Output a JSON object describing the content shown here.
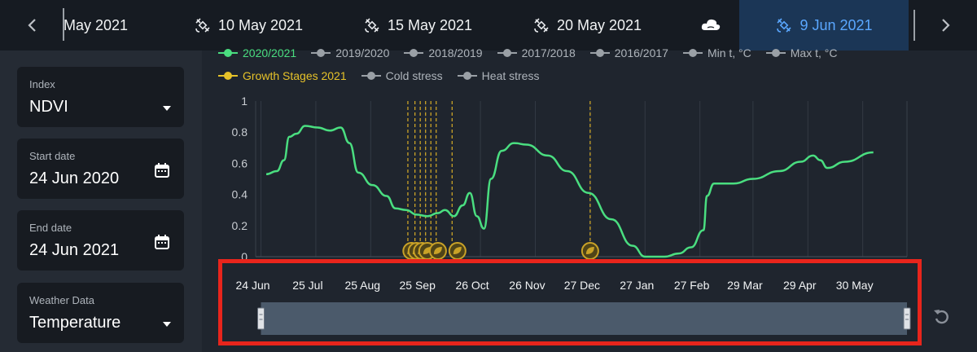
{
  "topbar": {
    "prev_icon": "chevron-left-icon",
    "next_icon": "chevron-right-icon",
    "dates": [
      {
        "label": "May 2021",
        "icon": "none"
      },
      {
        "label": "10 May 2021",
        "icon": "satellite-icon"
      },
      {
        "label": "15 May 2021",
        "icon": "satellite-icon"
      },
      {
        "label": "20 May 2021",
        "icon": "satellite-icon"
      },
      {
        "label": "",
        "icon": "cloud-icon"
      },
      {
        "label": "9 Jun 2021",
        "icon": "satellite-icon",
        "active": true
      }
    ]
  },
  "sidebar": {
    "index": {
      "label": "Index",
      "value": "NDVI"
    },
    "start_date": {
      "label": "Start date",
      "value": "24 Jun 2020"
    },
    "end_date": {
      "label": "End date",
      "value": "24 Jun 2021"
    },
    "weather": {
      "label": "Weather Data",
      "value": "Temperature"
    }
  },
  "legend": {
    "row1": [
      {
        "label": "2020/2021",
        "color": "#4ade80"
      },
      {
        "label": "2019/2020",
        "color": "#9aa0a6"
      },
      {
        "label": "2018/2019",
        "color": "#9aa0a6"
      },
      {
        "label": "2017/2018",
        "color": "#9aa0a6"
      },
      {
        "label": "2016/2017",
        "color": "#9aa0a6"
      },
      {
        "label": "Min t, °C",
        "color": "#9aa0a6"
      },
      {
        "label": "Max t, °C",
        "color": "#9aa0a6"
      }
    ],
    "row2": [
      {
        "label": "Growth Stages 2021",
        "color": "#e6c229"
      },
      {
        "label": "Cold stress",
        "color": "#9aa0a6"
      },
      {
        "label": "Heat stress",
        "color": "#9aa0a6"
      }
    ]
  },
  "colors": {
    "accent": "#5aa7ff",
    "series": "#4ade80",
    "growth": "#c9a227",
    "highlight": "#e8251c"
  },
  "chart_data": {
    "type": "line",
    "title": "",
    "xlabel": "",
    "ylabel": "",
    "ylim": [
      0,
      1
    ],
    "y_ticks": [
      "1",
      "0.8",
      "0.6",
      "0.4",
      "0.2",
      "0"
    ],
    "x_ticks": [
      "24 Jun",
      "25 Jul",
      "25 Aug",
      "25 Sep",
      "26 Oct",
      "26 Nov",
      "27 Dec",
      "27 Jan",
      "27 Feb",
      "29 Mar",
      "29 Apr",
      "30 May"
    ],
    "x_tick_dates": [
      "2020-06-24",
      "2020-07-25",
      "2020-08-25",
      "2020-09-25",
      "2020-10-26",
      "2020-11-26",
      "2020-12-27",
      "2021-01-27",
      "2021-02-27",
      "2021-03-29",
      "2021-04-29",
      "2021-05-30"
    ],
    "xlim": [
      "2020-06-21",
      "2021-06-24"
    ],
    "grid": true,
    "series": [
      {
        "name": "2020/2021",
        "color": "#4ade80",
        "points": [
          [
            "2020-06-27",
            0.53
          ],
          [
            "2020-07-03",
            0.55
          ],
          [
            "2020-07-07",
            0.62
          ],
          [
            "2020-07-10",
            0.77
          ],
          [
            "2020-07-14",
            0.79
          ],
          [
            "2020-07-19",
            0.84
          ],
          [
            "2020-07-26",
            0.83
          ],
          [
            "2020-08-02",
            0.81
          ],
          [
            "2020-08-08",
            0.83
          ],
          [
            "2020-08-13",
            0.73
          ],
          [
            "2020-08-18",
            0.54
          ],
          [
            "2020-08-26",
            0.46
          ],
          [
            "2020-09-03",
            0.39
          ],
          [
            "2020-09-08",
            0.31
          ],
          [
            "2020-09-14",
            0.3
          ],
          [
            "2020-09-20",
            0.27
          ],
          [
            "2020-09-26",
            0.26
          ],
          [
            "2020-10-02",
            0.28
          ],
          [
            "2020-10-06",
            0.3
          ],
          [
            "2020-10-11",
            0.26
          ],
          [
            "2020-10-16",
            0.33
          ],
          [
            "2020-10-20",
            0.41
          ],
          [
            "2020-10-24",
            0.26
          ],
          [
            "2020-10-28",
            0.18
          ],
          [
            "2020-11-01",
            0.5
          ],
          [
            "2020-11-07",
            0.68
          ],
          [
            "2020-11-14",
            0.73
          ],
          [
            "2020-11-21",
            0.72
          ],
          [
            "2020-12-03",
            0.65
          ],
          [
            "2020-12-14",
            0.55
          ],
          [
            "2020-12-26",
            0.41
          ],
          [
            "2021-01-08",
            0.24
          ],
          [
            "2021-01-20",
            0.07
          ],
          [
            "2021-01-27",
            0.0
          ],
          [
            "2021-02-07",
            0.0
          ],
          [
            "2021-02-15",
            0.02
          ],
          [
            "2021-02-22",
            0.06
          ],
          [
            "2021-03-01",
            0.17
          ],
          [
            "2021-03-03",
            0.39
          ],
          [
            "2021-03-07",
            0.47
          ],
          [
            "2021-03-18",
            0.47
          ],
          [
            "2021-03-29",
            0.5
          ],
          [
            "2021-04-13",
            0.55
          ],
          [
            "2021-04-25",
            0.61
          ],
          [
            "2021-05-02",
            0.65
          ],
          [
            "2021-05-06",
            0.62
          ],
          [
            "2021-05-10",
            0.57
          ],
          [
            "2021-05-20",
            0.61
          ],
          [
            "2021-06-05",
            0.67
          ]
        ]
      }
    ],
    "growth_stage_dates": [
      "2020-09-15",
      "2020-09-19",
      "2020-09-22",
      "2020-09-25",
      "2020-09-28",
      "2020-10-01",
      "2020-10-10",
      "2020-12-27"
    ],
    "growth_stage_icons": [
      "2020-09-17",
      "2020-09-20",
      "2020-09-23",
      "2020-09-26",
      "2020-10-02",
      "2020-10-13",
      "2020-12-27"
    ],
    "range_selector": {
      "start": "2020-06-24",
      "end": "2021-06-24"
    }
  }
}
